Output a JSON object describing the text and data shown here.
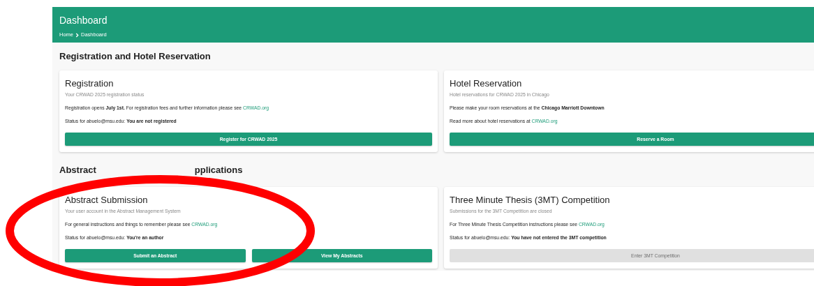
{
  "header": {
    "title": "Dashboard",
    "breadcrumbs": [
      {
        "label": "Home"
      },
      {
        "label": "Dashboard"
      }
    ]
  },
  "sections": [
    {
      "heading": "Registration and Hotel Reservation",
      "cards": [
        {
          "title": "Registration",
          "subtitle": "Your CRWAD 2025 registration status",
          "paragraphs": [
            {
              "text": "Registration opens **July 1st.** For registration fees and further information please see ",
              "link": "CRWAD.org"
            },
            {
              "text": "Status for abuelo@msu.edu: **You are not registered**"
            }
          ],
          "buttons": [
            {
              "label": "Register for CRWAD 2025",
              "disabled": false
            }
          ]
        },
        {
          "title": "Hotel Reservation",
          "subtitle": "Hotel reservations for CRWAD 2025 in Chicago",
          "paragraphs": [
            {
              "text": "Please make your room reservations at the **Chicago Marriott Downtown**"
            },
            {
              "text": "Read more about hotel reservations at ",
              "link": "CRWAD.org"
            }
          ],
          "buttons": [
            {
              "label": "Reserve a Room",
              "disabled": false
            }
          ]
        }
      ]
    },
    {
      "heading_parts": [
        "Abstract",
        "pplications"
      ],
      "cards": [
        {
          "title": "Abstract Submission",
          "subtitle": "Your user account in the Abstract Management System",
          "paragraphs": [
            {
              "text": "For general instructions and things to remember please see ",
              "link": "CRWAD.org"
            },
            {
              "text": "Status for abuelo@msu.edu: **You're an author**"
            }
          ],
          "buttons": [
            {
              "label": "Submit an Abstract",
              "disabled": false
            },
            {
              "label": "View My Abstracts",
              "disabled": false
            }
          ]
        },
        {
          "title": "Three Minute Thesis (3MT) Competition",
          "subtitle": "Submissions for the 3MT Competition are closed",
          "paragraphs": [
            {
              "text": "For Three Minute Thesis Competition instructions please see ",
              "link": "CRWAD.org"
            },
            {
              "text": "Status for abuelo@msu.edu: **You have not entered the 3MT competition**"
            }
          ],
          "buttons": [
            {
              "label": "Enter 3MT Competition",
              "disabled": true
            }
          ]
        }
      ]
    }
  ],
  "annotations": [
    {
      "kind": "ellipse"
    }
  ]
}
